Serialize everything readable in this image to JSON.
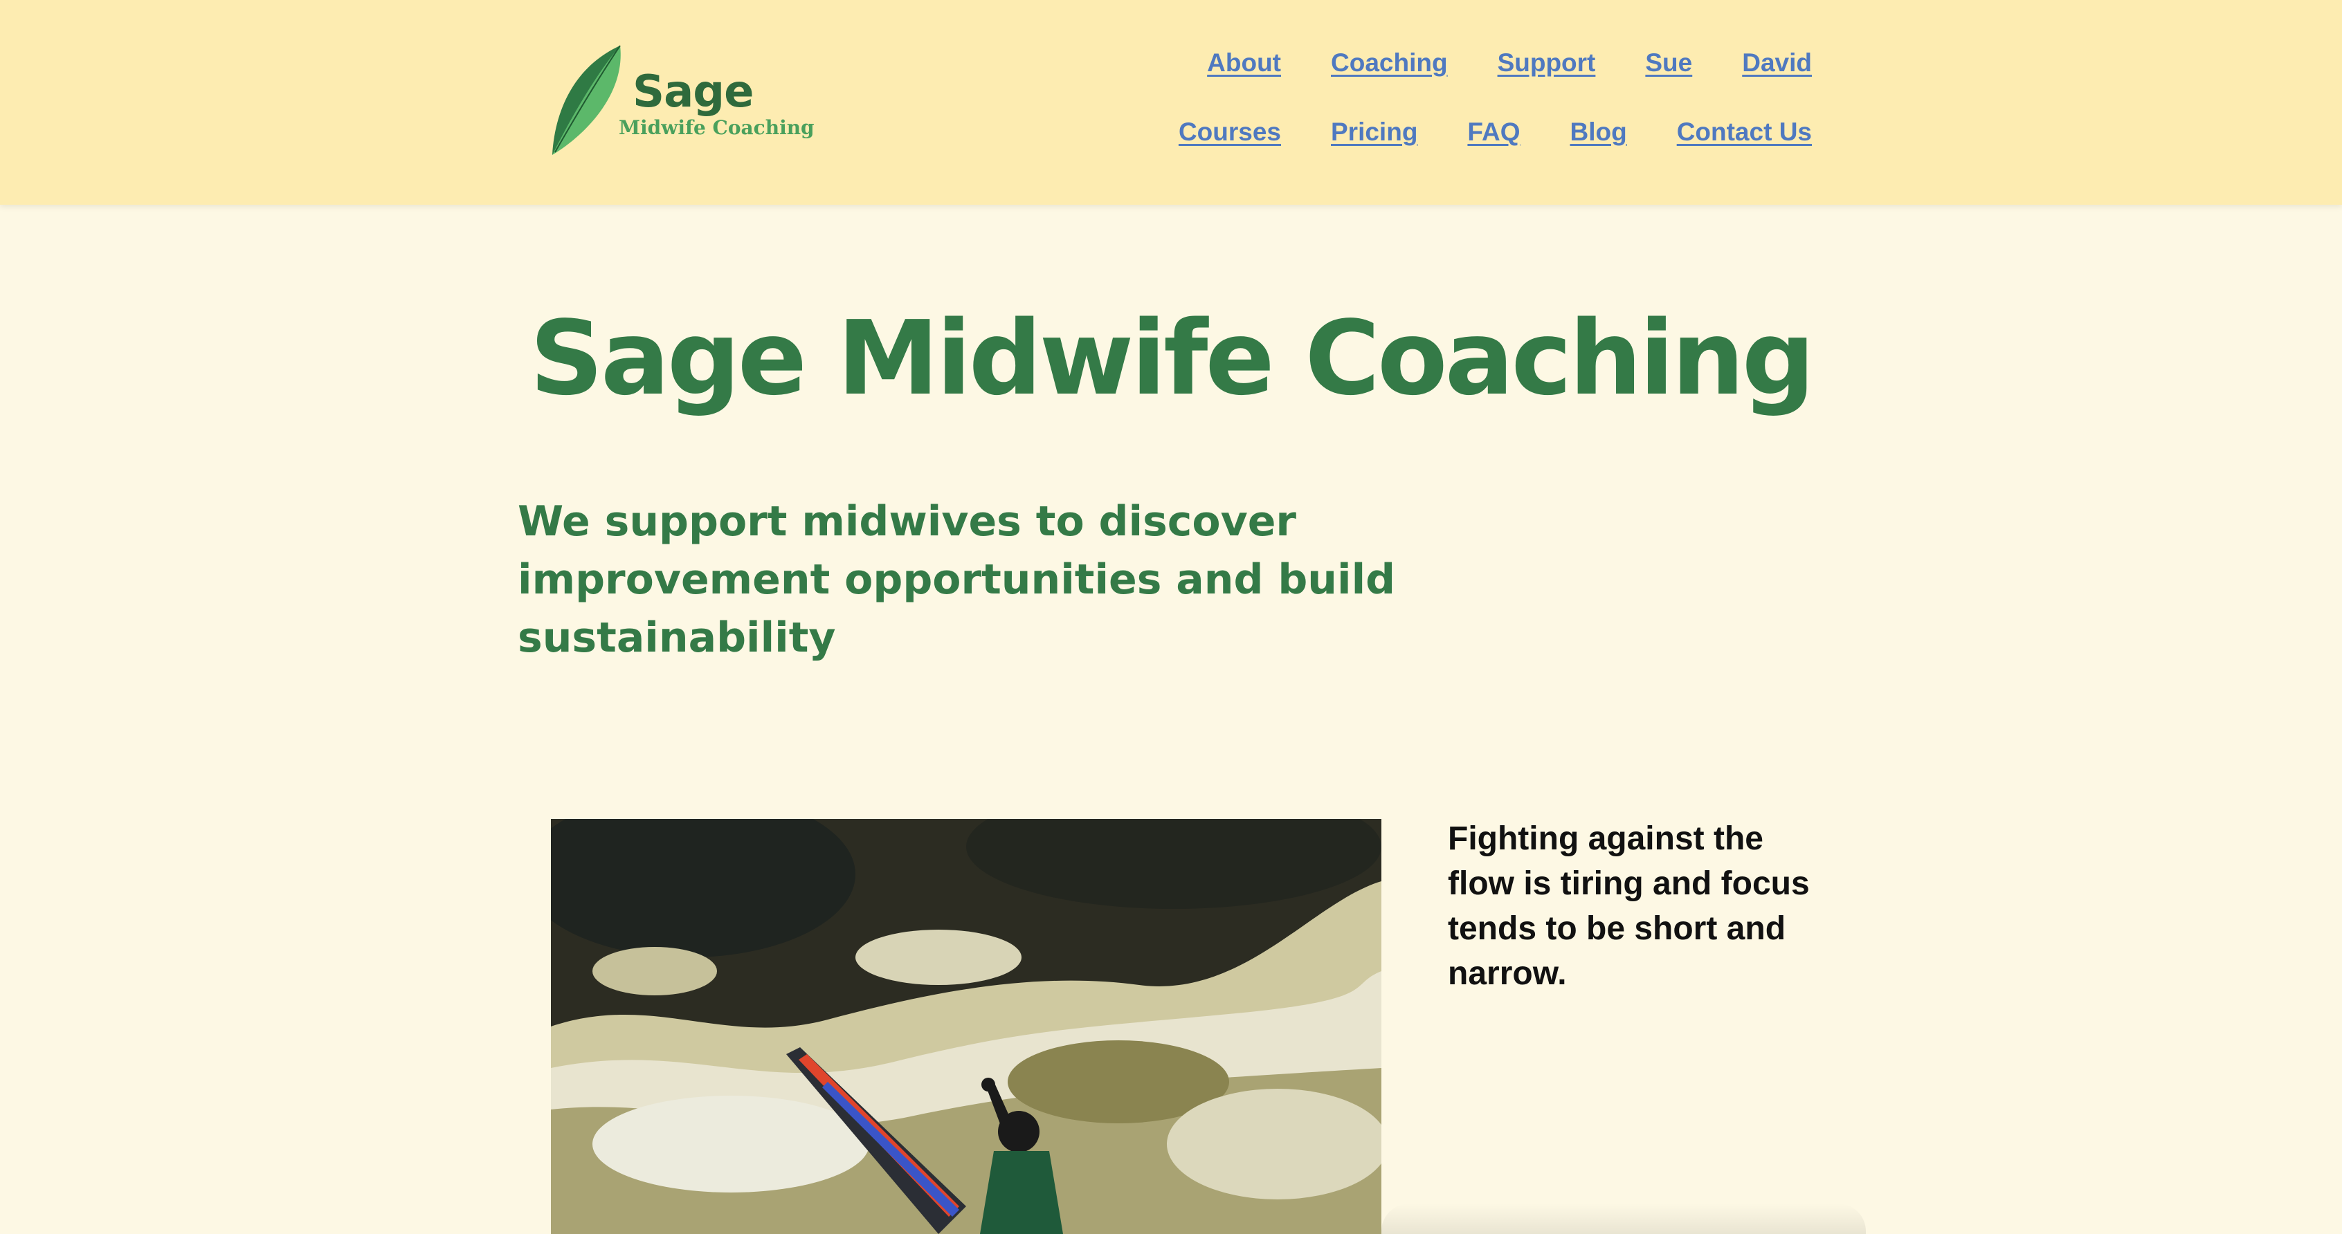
{
  "header": {
    "logo": {
      "name": "Sage",
      "tagline": "Midwife Coaching"
    },
    "nav_row1": [
      "About",
      "Coaching",
      "Support",
      "Sue",
      "David"
    ],
    "nav_row2": [
      "Courses",
      "Pricing",
      "FAQ",
      "Blog",
      "Contact Us"
    ]
  },
  "hero": {
    "title": "Sage Midwife Coaching",
    "subtitle": "We support midwives to discover improvement opportunities and build sustainability"
  },
  "feature": {
    "image_icon": "kayak-photo",
    "caption": "Fighting against the flow is tiring and focus tends to be short and narrow."
  },
  "colors": {
    "header_bg": "#fdecb1",
    "page_bg": "#fdf8e4",
    "brand_green": "#347a47",
    "link_blue": "#4f79c0"
  }
}
